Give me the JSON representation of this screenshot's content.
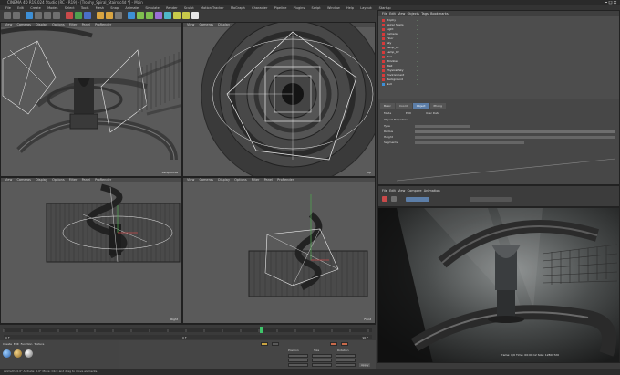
{
  "window": {
    "title": "CINEMA 4D R19.024 Studio (RC - R19) - [Trophy_Spiral_Stairs.c4d *] - Main"
  },
  "menubar": {
    "items": [
      "File",
      "Edit",
      "Create",
      "Modes",
      "Select",
      "Tools",
      "Mesh",
      "Snap",
      "Animate",
      "Simulate",
      "Render",
      "Sculpt",
      "Motion Tracker",
      "MoGraph",
      "Character",
      "Pipeline",
      "Plugins",
      "Script",
      "Window",
      "Help",
      "Layout:",
      "Startup"
    ]
  },
  "viewports": {
    "perspective": {
      "menu": [
        "View",
        "Cameras",
        "Display",
        "Options",
        "Filter",
        "Panel",
        "ProRender"
      ],
      "label": "Perspective"
    },
    "top": {
      "menu": [
        "View",
        "Cameras",
        "Display",
        "Options",
        "Filter",
        "Panel",
        "ProRender"
      ],
      "label": "Top"
    },
    "right": {
      "menu": [
        "View",
        "Cameras",
        "Display",
        "Options",
        "Filter",
        "Panel",
        "ProRender"
      ],
      "label": "Right"
    },
    "front": {
      "menu": [
        "View",
        "Cameras",
        "Display",
        "Options",
        "Filter",
        "Panel",
        "ProRender"
      ],
      "label": "Front"
    }
  },
  "object_manager": {
    "tabs": [
      "File",
      "Edit",
      "View",
      "Objects",
      "Tags",
      "Bookmarks"
    ],
    "objects": [
      "Trophy",
      "Spiral_Stairs",
      "Light",
      "Camera",
      "Floor",
      "Sky",
      "Lamp_01",
      "Lamp_02",
      "Rail",
      "Window",
      "Wall",
      "Physical Sky",
      "Environment",
      "Background",
      "Null"
    ]
  },
  "attribute_manager": {
    "tabs": [
      "Basic",
      "Coord.",
      "Object",
      "Phong"
    ],
    "active_tab": "Object",
    "rows": [
      "Mode",
      "Edit",
      "User Data",
      "Object Properties",
      "Type",
      "Radius",
      "Height",
      "Segments"
    ]
  },
  "render_view": {
    "menu": [
      "File",
      "Edit",
      "View",
      "Compare",
      "Animation"
    ],
    "caption": "Frame: 0/0  Time: 00:00:12  Size: 1280x720"
  },
  "timeline": {
    "start": "0 F",
    "end": "90 F",
    "current": "0 F"
  },
  "materials": {
    "menu": [
      "Create",
      "Edit",
      "Function",
      "Texture"
    ]
  },
  "coordinates": {
    "labels": [
      "Position",
      "Size",
      "Rotation"
    ],
    "apply": "Apply"
  },
  "status": {
    "text": "Azimuth: 0.0°  Altitude: 0.0°  Move: Click and drag to move elements."
  },
  "colors": {
    "accent": "#5c7ea8",
    "object_icon": "#d63a3a",
    "bg": "#3b3b3b"
  }
}
